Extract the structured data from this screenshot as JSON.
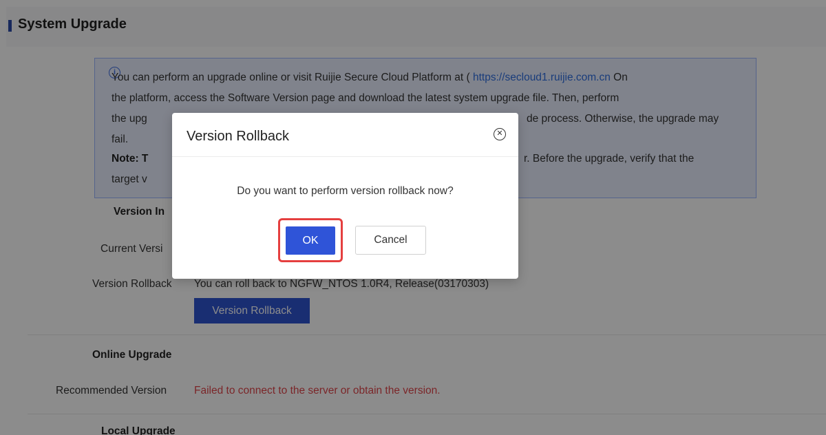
{
  "page": {
    "title": "System Upgrade"
  },
  "notice": {
    "line1_prefix": "You can perform an upgrade online or visit Ruijie Secure Cloud Platform at ( ",
    "line1_link": "https://secloud1.ruijie.com.cn",
    "line1_suffix": " On",
    "line2": "the platform, access the Software Version page and download the latest system upgrade file. Then, perform",
    "line3_left": "the upg",
    "line3_right": "de process. Otherwise, the upgrade may",
    "line4": "fail.",
    "note_label": "Note: T",
    "note_right": "r. Before the upgrade, verify that the",
    "line6_left": "target v"
  },
  "version_info": {
    "section_label": "Version In",
    "current_version_label": "Current Versi",
    "rollback_label": "Version Rollback",
    "rollback_text": "You can roll back to NGFW_NTOS 1.0R4, Release(03170303)",
    "rollback_button": "Version Rollback"
  },
  "online_upgrade": {
    "section_label": "Online Upgrade",
    "recommended_label": "Recommended Version",
    "recommended_value": "Failed to connect to the server or obtain the version."
  },
  "local_upgrade": {
    "section_label": "Local Upgrade"
  },
  "modal": {
    "title": "Version Rollback",
    "close_glyph": "✕",
    "message": "Do you want to perform version rollback now?",
    "ok_label": "OK",
    "cancel_label": "Cancel"
  },
  "colors": {
    "primary": "#2f54d8",
    "error": "#e0464b",
    "highlight": "#e53f3f",
    "link": "#2f6ee0"
  }
}
